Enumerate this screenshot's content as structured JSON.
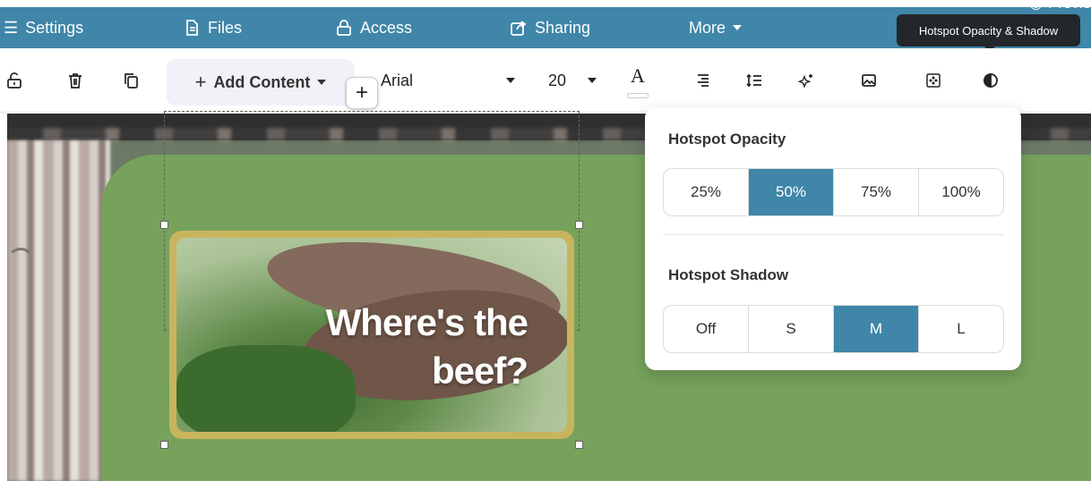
{
  "nav": {
    "items": [
      {
        "label": "Settings",
        "icon": "list-icon"
      },
      {
        "label": "Files",
        "icon": "file-icon"
      },
      {
        "label": "Access",
        "icon": "lock-icon"
      },
      {
        "label": "Sharing",
        "icon": "share-icon"
      },
      {
        "label": "More",
        "icon": "chevron-down-icon"
      }
    ],
    "preview_label": "Previe",
    "accent": "#3f86a8"
  },
  "tooltip": "Hotspot Opacity & Shadow",
  "toolbar": {
    "add_content": "Add Content",
    "font": "Arial",
    "size": "20",
    "font_color_glyph": "A"
  },
  "canvas": {
    "panel_color": "#76a25c",
    "add_glyph": "+",
    "hotspot": {
      "line1": "Where's the",
      "line2": "beef?"
    }
  },
  "popover": {
    "opacity_heading": "Hotspot Opacity",
    "opacity_options": [
      "25%",
      "50%",
      "75%",
      "100%"
    ],
    "opacity_selected": "50%",
    "shadow_heading": "Hotspot Shadow",
    "shadow_options": [
      "Off",
      "S",
      "M",
      "L"
    ],
    "shadow_selected": "M"
  }
}
